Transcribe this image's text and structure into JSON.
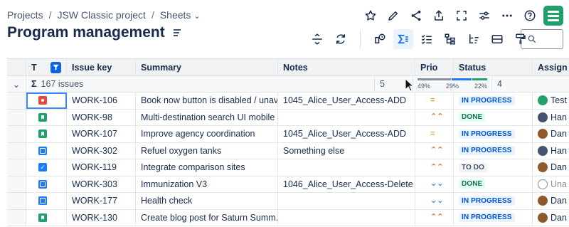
{
  "breadcrumb": {
    "items": [
      "Projects",
      "JSW Classic project",
      "Sheets"
    ],
    "separator": "/"
  },
  "page": {
    "title": "Program management"
  },
  "top_icons": [
    "star-icon",
    "pencil-icon",
    "share-icon",
    "export-icon",
    "fullscreen-icon",
    "settings-sliders-icon",
    "more-icon",
    "help-icon",
    "app-logo"
  ],
  "toolbar": [
    "row-height-icon",
    "refresh-icon",
    "history-icon",
    "sum-icon",
    "checklist-icon",
    "hierarchy-icon",
    "hierarchy-sort-icon",
    "card-view-icon",
    "paint-format-icon"
  ],
  "search": {
    "placeholder": ""
  },
  "columns": {
    "type": "T",
    "key": "Issue key",
    "summary": "Summary",
    "notes": "Notes",
    "prio": "Prio",
    "status": "Status",
    "assignee": "Assign"
  },
  "group": {
    "sigma": "Σ",
    "count_label": "167 issues",
    "prio_count": "5",
    "assignee_count": "4",
    "status_breakdown": [
      {
        "label": "49%",
        "color": "#8590a2",
        "fraction": 0.49
      },
      {
        "label": "29%",
        "color": "#1d7afc",
        "fraction": 0.29
      },
      {
        "label": "22%",
        "color": "#22a06b",
        "fraction": 0.22
      }
    ]
  },
  "rows": [
    {
      "type": "bug",
      "key": "WORK-106",
      "summary": "Book now button is disabled / unav...",
      "notes": "1045_Alice_User_Access-ADD",
      "prio": "medium",
      "status": "IN PROGRESS",
      "status_kind": "progress",
      "assignee": "Test",
      "avatar": "av-green",
      "selected": true
    },
    {
      "type": "story",
      "key": "WORK-98",
      "summary": "Multi-destination search UI mobile",
      "notes": "",
      "prio": "high",
      "status": "DONE",
      "status_kind": "done",
      "assignee": "Han",
      "avatar": "av-dark"
    },
    {
      "type": "story",
      "key": "WORK-107",
      "summary": "Improve agency coordination",
      "notes": "1045_Alice_User_Access-ADD",
      "prio": "medium",
      "status": "IN PROGRESS",
      "status_kind": "progress",
      "assignee": "Dan",
      "avatar": "av-brown"
    },
    {
      "type": "subtask",
      "key": "WORK-302",
      "summary": "Refuel oxygen tanks",
      "notes": "Something else",
      "prio": "high",
      "status": "IN PROGRESS",
      "status_kind": "progress",
      "assignee": "Han",
      "avatar": "av-dark"
    },
    {
      "type": "task",
      "key": "WORK-119",
      "summary": "Integrate comparison sites",
      "notes": "",
      "prio": "high",
      "status": "TO DO",
      "status_kind": "todo",
      "assignee": "Dan",
      "avatar": "av-brown"
    },
    {
      "type": "subtask",
      "key": "WORK-303",
      "summary": "Immunization V3",
      "notes": "1046_Alice_User_Access-Delete",
      "prio": "low",
      "status": "DONE",
      "status_kind": "done",
      "assignee": "Una",
      "avatar": "av-grey",
      "assignee_muted": true
    },
    {
      "type": "subtask",
      "key": "WORK-177",
      "summary": "Health check",
      "notes": "",
      "prio": "low",
      "status": "IN PROGRESS",
      "status_kind": "progress",
      "assignee": "Dan",
      "avatar": "av-brown"
    },
    {
      "type": "story",
      "key": "WORK-130",
      "summary": "Create blog post for Saturn Summ...",
      "notes": "",
      "prio": "high",
      "status": "IN PROGRESS",
      "status_kind": "progress",
      "assignee": "Dan",
      "avatar": "av-brown"
    }
  ],
  "priority_glyphs": {
    "medium": "=",
    "high": "⌃⌃",
    "low": "⌄⌄"
  }
}
